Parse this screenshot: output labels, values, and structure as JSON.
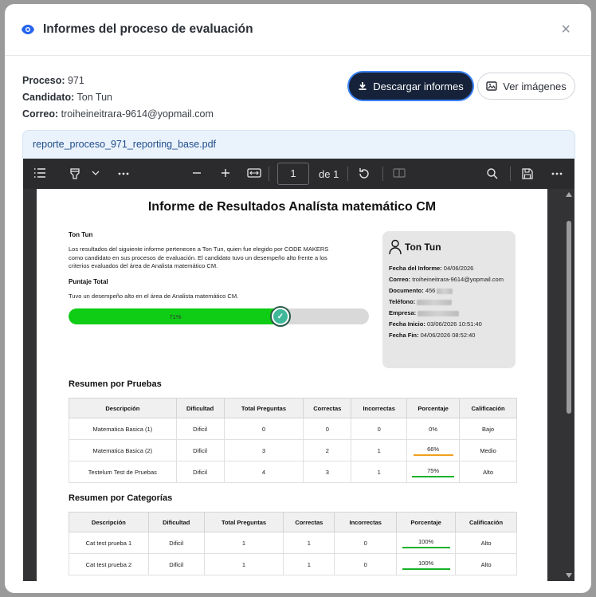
{
  "modal": {
    "title": "Informes del proceso de evaluación",
    "close_icon": "×"
  },
  "info": {
    "proceso_label": "Proceso:",
    "proceso_value": "971",
    "candidato_label": "Candidato:",
    "candidato_value": "Ton Tun",
    "correo_label": "Correo:",
    "correo_value": "troiheineitrara-9614@yopmail.com"
  },
  "buttons": {
    "download": "Descargar informes",
    "images": "Ver imágenes"
  },
  "file": {
    "name": "reporte_proceso_971_reporting_base.pdf"
  },
  "viewer": {
    "page_number": "1",
    "page_of": "de 1"
  },
  "report": {
    "title": "Informe de Resultados Analísta matemático CM",
    "candidate_name": "Ton Tun",
    "intro": "Los resultados del siguiente informe pertenecen a Ton Tun, quien fue elegido por CODE MAKERS como candidato en sus procesos de evaluación. El candidato tuvo un desempeño alto frente a los criterios evaluados del área de Analista matemático CM.",
    "score_heading": "Puntaje Total",
    "score_text": "Tuvo un desempeño alto en el área de Analista matemático CM.",
    "score_label": "71%",
    "score_value": 0.71,
    "card": {
      "name": "Ton Tun",
      "fecha_informe_label": "Fecha del Informe:",
      "fecha_informe": "04/06/2026",
      "correo_label": "Correo:",
      "correo": "troiheineitrara-9614@yopmail.com",
      "documento_label": "Documento:",
      "documento": "456",
      "telefono_label": "Teléfono:",
      "empresa_label": "Empresa:",
      "fecha_inicio_label": "Fecha Inicio:",
      "fecha_inicio": "03/06/2026 10:51:40",
      "fecha_fin_label": "Fecha Fin:",
      "fecha_fin": "04/06/2026 08:52:40"
    },
    "pruebas_title": "Resumen por Pruebas",
    "pruebas_headers": [
      "Descripción",
      "Dificultad",
      "Total Preguntas",
      "Correctas",
      "Incorrectas",
      "Porcentaje",
      "Calificación"
    ],
    "pruebas_rows": [
      [
        "Matematica Basica (1)",
        "Dificil",
        "0",
        "0",
        "0",
        "0%",
        "Bajo"
      ],
      [
        "Matematica Basica (2)",
        "Dificil",
        "3",
        "2",
        "1",
        "66%",
        "Medio"
      ],
      [
        "Testelum Test de Pruebas",
        "Dificil",
        "4",
        "3",
        "1",
        "75%",
        "Alto"
      ]
    ],
    "categorias_title": "Resumen por Categorías",
    "categorias_headers": [
      "Descripción",
      "Dificultad",
      "Total Preguntas",
      "Correctas",
      "Incorrectas",
      "Porcentaje",
      "Calificación"
    ],
    "categorias_rows": [
      [
        "Cat test prueba 1",
        "Dificil",
        "1",
        "1",
        "0",
        "100%",
        "Alto"
      ],
      [
        "Cat test prueba 2",
        "Dificil",
        "1",
        "1",
        "0",
        "100%",
        "Alto"
      ]
    ]
  },
  "colors": {
    "accent": "#152239",
    "progress": "#0fcc15",
    "medio": "#f0a020",
    "alto": "#16b22a"
  }
}
